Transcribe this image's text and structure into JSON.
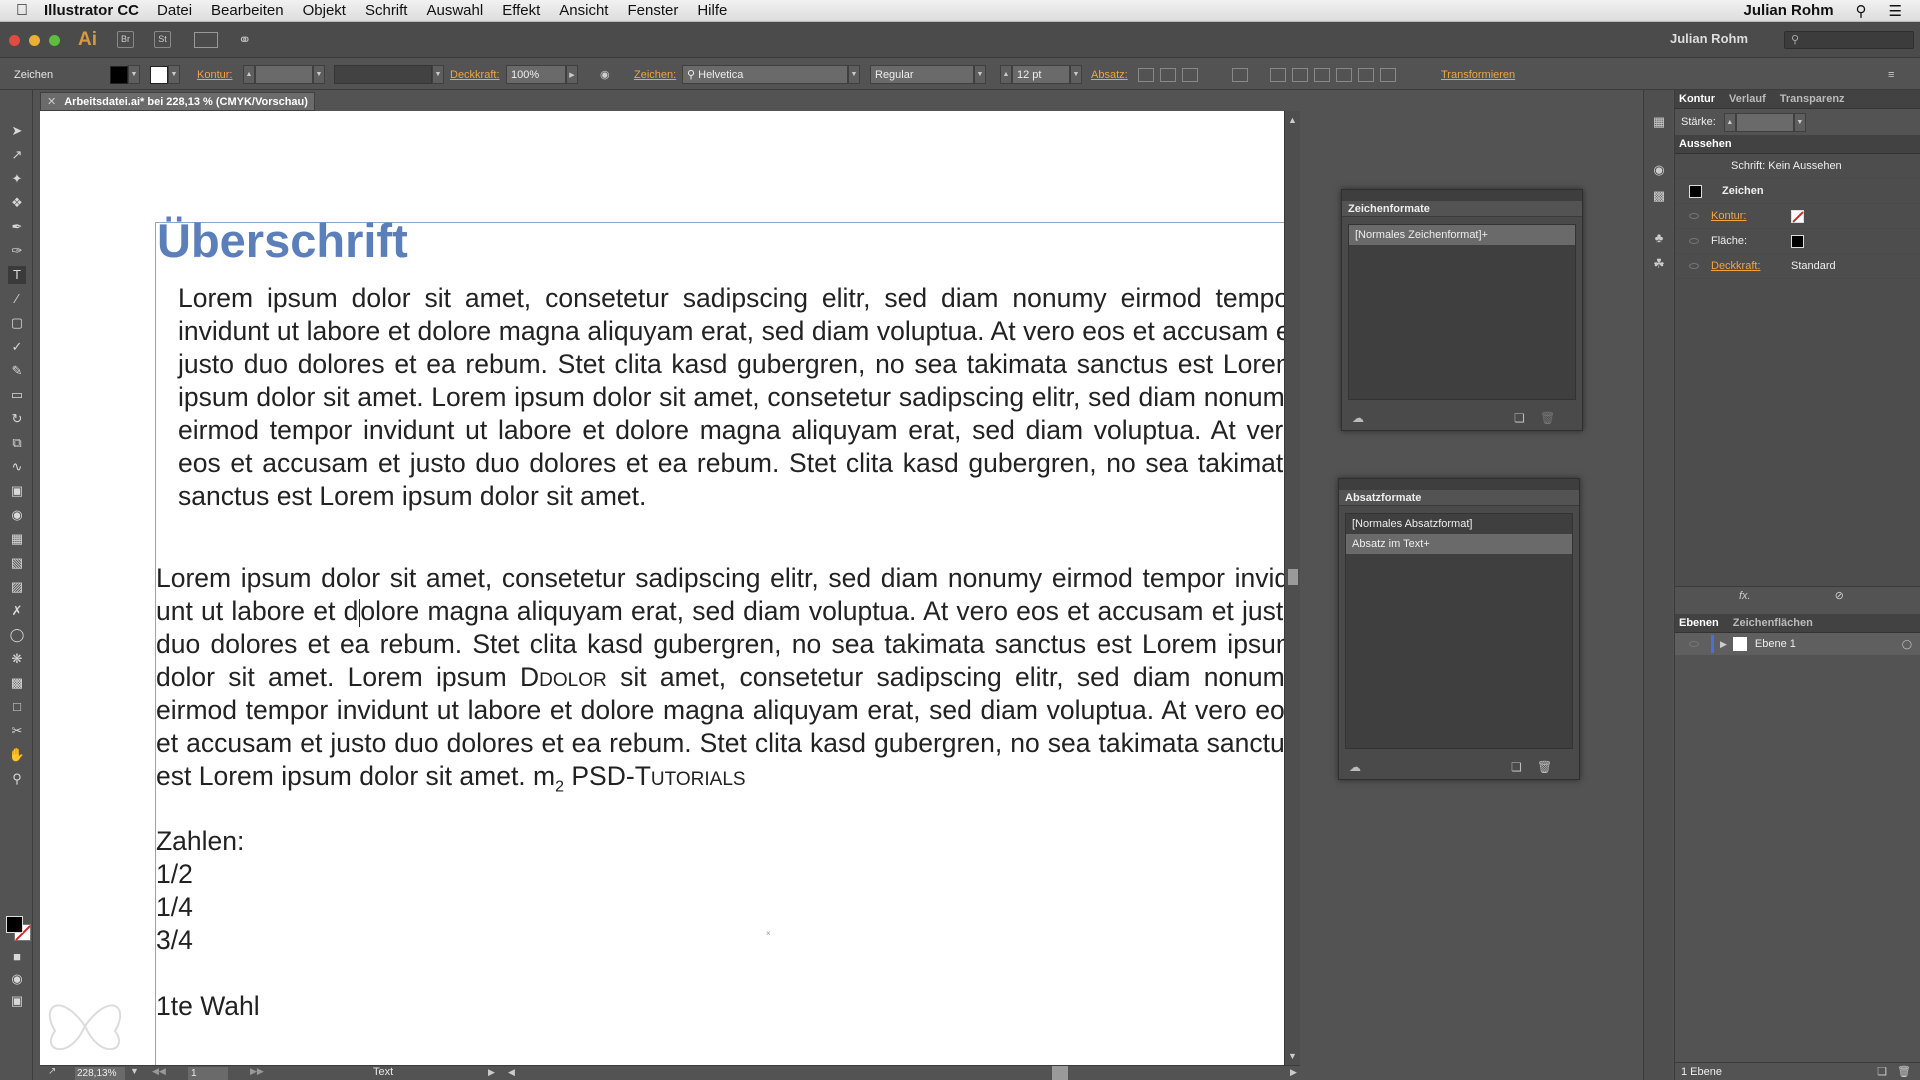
{
  "menubar": {
    "app_name": "Illustrator CC",
    "menus": [
      "Datei",
      "Bearbeiten",
      "Objekt",
      "Schrift",
      "Auswahl",
      "Effekt",
      "Ansicht",
      "Fenster",
      "Hilfe"
    ],
    "user": "Julian Rohm"
  },
  "appbar": {
    "logo": "Ai",
    "bridge": "Br",
    "stock": "St",
    "workspace": "Julian Rohm"
  },
  "control": {
    "tool_label": "Zeichen",
    "kontur_label": "Kontur:",
    "deckkraft_label": "Deckkraft:",
    "deckkraft_value": "100%",
    "zeichen_label": "Zeichen:",
    "font_family": "Helvetica",
    "font_style": "Regular",
    "font_size": "12 pt",
    "absatz_label": "Absatz:",
    "transformieren": "Transformieren"
  },
  "document": {
    "tab_title": "Arbeitsdatei.ai* bei 228,13 % (CMYK/Vorschau)",
    "heading": "Überschrift",
    "para1": "Lorem ipsum dolor sit amet, consetetur sadipscing elitr, sed diam nonumy eirmod tempor invidunt ut labore et dolore magna aliquyam erat, sed diam voluptua. At vero eos et accusam et justo duo dolores et ea rebum. Stet clita kasd gubergren, no sea takimata sanctus est Lorem ipsum dolor sit amet. Lorem ipsum dolor sit amet, consetetur sadipscing elitr, sed diam nonumy eirmod tempor invidunt ut labore et dolore magna aliquyam erat, sed diam voluptua. At vero eos et accusam et justo duo dolores et ea rebum. Stet clita kasd gubergren, no sea takimata sanctus est Lorem ipsum dolor sit amet.",
    "para2_a": "Lorem ipsum dolor sit amet, consetetur sadipscing elitr, sed diam nonumy eirmod tempor invid-unt ut labore et d",
    "para2_b": "olore magna aliquyam erat, sed diam voluptua. At vero eos et accusam et justo duo dolores et ea rebum. Stet clita kasd gubergren, no sea takimata sanctus est Lorem ipsum dolor sit amet. Lorem ipsum ",
    "para2_smallcaps": "Ddolor",
    "para2_c": " sit amet, consetetur sadipscing elitr, sed diam nonumy eirmod tempor invidunt ut labore et dolore magna aliquyam erat, sed diam voluptua. At vero eos et accusam et justo duo dolores et ea rebum. Stet clita kasd gubergren, no sea takimata sanctus est Lorem ipsum dolor sit amet. m",
    "para2_sub": "2",
    "para2_psd": " PSD-T",
    "para2_psd_sc": "utorials",
    "zahlen_label": "Zahlen:",
    "fractions": [
      "1/2",
      "1/4",
      "3/4"
    ],
    "ordinal": "1te Wahl"
  },
  "status": {
    "zoom": "228,13%",
    "page": "1",
    "mode": "Text"
  },
  "zeichenformate": {
    "title": "Zeichenformate",
    "items": [
      "[Normales Zeichenformat]+"
    ]
  },
  "absatzformate": {
    "title": "Absatzformate",
    "items": [
      "[Normales Absatzformat]",
      "Absatz im Text+"
    ]
  },
  "rightpanel": {
    "tabs_top": [
      "Kontur",
      "Verlauf",
      "Transparenz"
    ],
    "staerke_label": "Stärke:",
    "aussehen_title": "Aussehen",
    "schrift_row": "Schrift: Kein Aussehen",
    "zeichen_row": "Zeichen",
    "kontur_row": "Kontur:",
    "flaeche_row": "Fläche:",
    "deckkraft_row": "Deckkraft:",
    "deckkraft_value": "Standard",
    "fx": "fx.",
    "tabs_layers": [
      "Ebenen",
      "Zeichenflächen"
    ],
    "layer_name": "Ebene 1",
    "layer_count": "1 Ebene"
  }
}
